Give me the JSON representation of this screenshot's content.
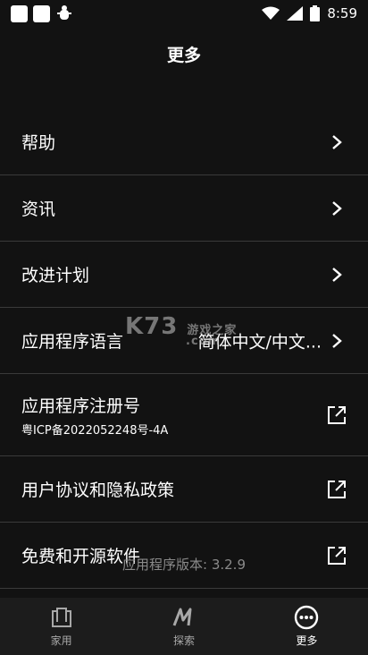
{
  "status_bar": {
    "time": "8:59"
  },
  "header": {
    "title": "更多"
  },
  "menu": [
    {
      "label": "帮助",
      "icon": "chevron-right-icon"
    },
    {
      "label": "资讯",
      "icon": "chevron-right-icon"
    },
    {
      "label": "改进计划",
      "icon": "chevron-right-icon"
    },
    {
      "label": "应用程序语言",
      "value": "简体中文/中文...",
      "icon": "chevron-right-icon"
    },
    {
      "label": "应用程序注册号",
      "sub": "粤ICP备2022052248号-4A",
      "icon": "external-link-icon"
    },
    {
      "label": "用户协议和隐私政策",
      "icon": "external-link-icon"
    },
    {
      "label": "免费和开源软件",
      "icon": "external-link-icon"
    }
  ],
  "version": "应用程序版本: 3.2.9",
  "watermark": {
    "brand": "K73",
    "text": "游戏之家",
    "domain": ".com"
  },
  "nav": [
    {
      "label": "家用",
      "icon": "home-icon",
      "active": false
    },
    {
      "label": "探索",
      "icon": "explore-icon",
      "active": false
    },
    {
      "label": "更多",
      "icon": "more-icon",
      "active": true
    }
  ]
}
